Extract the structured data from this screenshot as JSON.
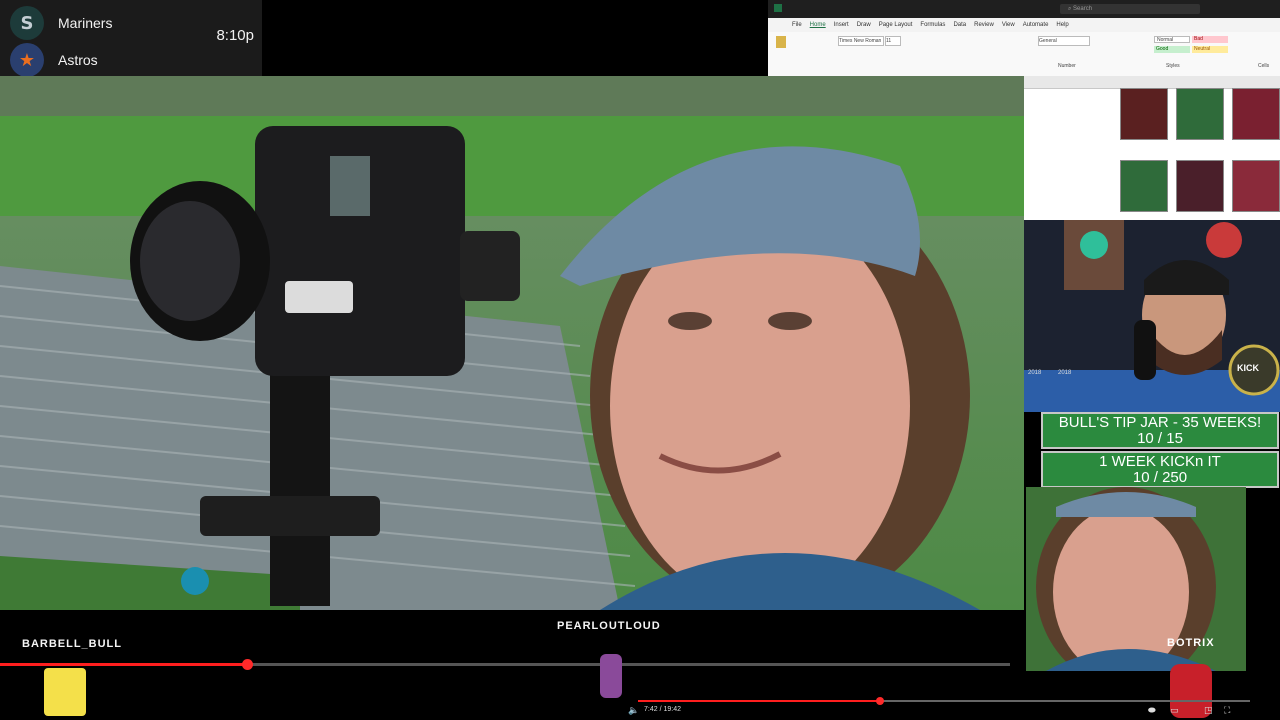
{
  "scoreboard": {
    "teams": [
      {
        "name": "Mariners",
        "logo_icon": "mariners-logo-icon",
        "logo_glyph": "S",
        "color": "#1d3b3a"
      },
      {
        "name": "Astros",
        "logo_icon": "astros-logo-icon",
        "logo_glyph": "★",
        "color": "#2a3f6f"
      }
    ],
    "time": "8:10p"
  },
  "excel": {
    "tabs": [
      "File",
      "Home",
      "Insert",
      "Draw",
      "Page Layout",
      "Formulas",
      "Data",
      "Review",
      "View",
      "Automate",
      "Help"
    ],
    "search_placeholder": "Search",
    "font_name": "Times New Roman",
    "font_size": "11",
    "number_format": "General",
    "styles": [
      {
        "label": "Normal",
        "color": "#ffffff"
      },
      {
        "label": "Bad",
        "color": "#ffc7ce"
      },
      {
        "label": "Good",
        "color": "#c6efce"
      },
      {
        "label": "Neutral",
        "color": "#ffeb9c"
      }
    ],
    "group_labels": [
      "Number",
      "Styles",
      "Cells"
    ],
    "row_years": [
      "2018",
      "2018"
    ]
  },
  "goals": [
    {
      "title": "BULL'S TIP JAR - 35 WEEKS!",
      "value": "10 / 15"
    },
    {
      "title": "1 WEEK KICKn IT",
      "value": "10 / 250"
    }
  ],
  "webcam_badge": "KICK",
  "bottom": {
    "left_user": "BARBELL_BULL",
    "center_user": "PEARLOUTLOUD",
    "right_user": "BOTRIX",
    "progress_fraction": 0.245
  },
  "mini_player": {
    "time": "7:42 / 19:42",
    "progress_fraction": 0.395
  },
  "colors": {
    "accent_red": "#ff1e1e",
    "goal_green": "#2b8a3e"
  }
}
